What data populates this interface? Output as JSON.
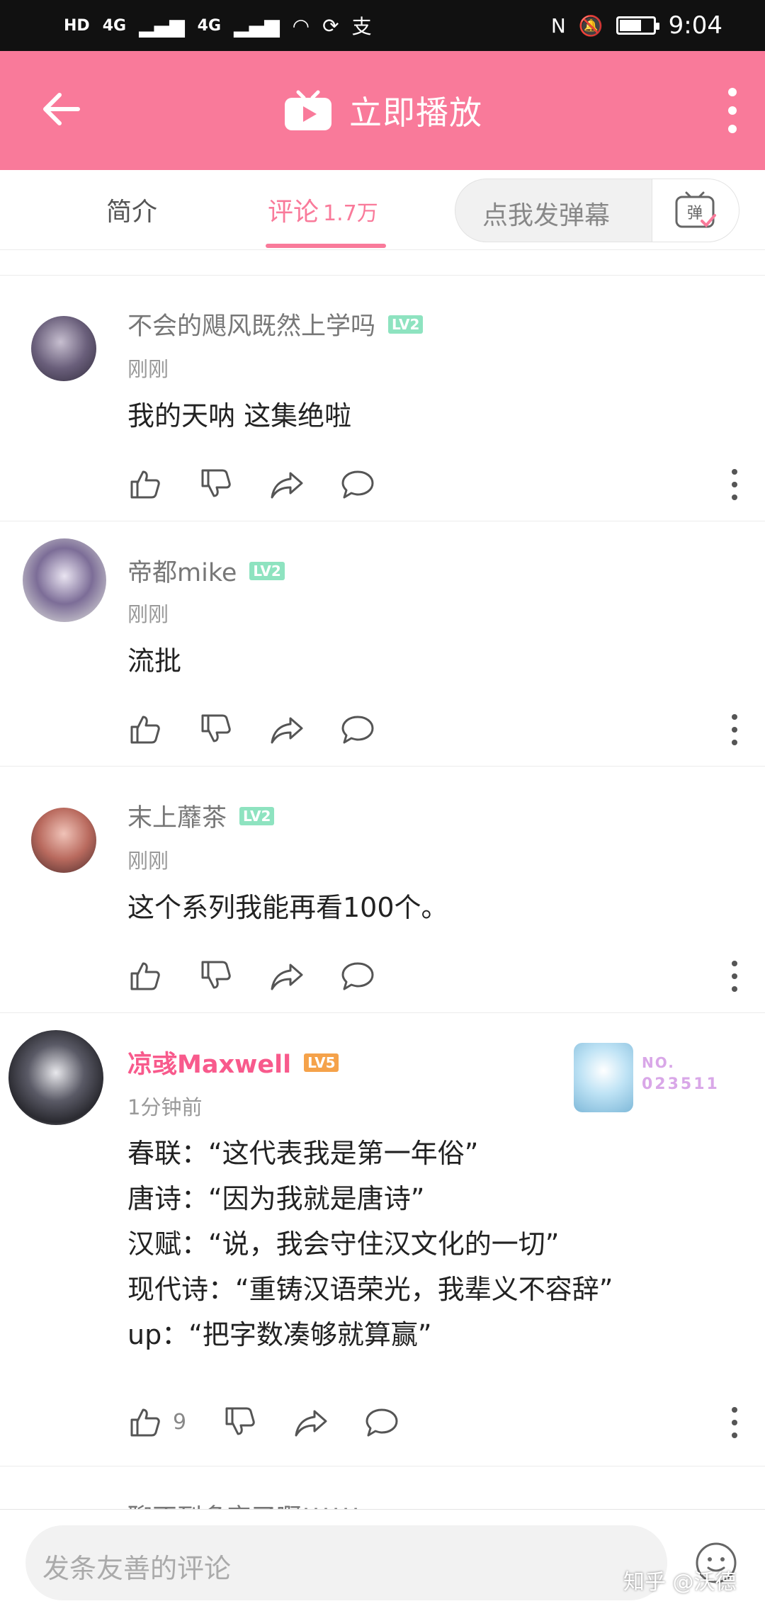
{
  "status_bar": {
    "sim1": "HD",
    "sim2": "HD",
    "net1": "4G",
    "net2": "4G",
    "app_badge": "支",
    "time": "9:04"
  },
  "app_bar": {
    "title": "立即播放",
    "accent_color": "#f97a9a"
  },
  "tabs": {
    "intro_label": "简介",
    "comments_label": "评论",
    "comments_count": "1.7万",
    "danmu_label": "点我发弹幕",
    "danmu_icon_char": "弹"
  },
  "comments": [
    {
      "username": "不会的飓风既然上学吗",
      "level": "LV2",
      "time": "刚刚",
      "text": "我的天呐 这集绝啦",
      "likes": ""
    },
    {
      "username": "帝都mike",
      "level": "LV2",
      "time": "刚刚",
      "text": "流批",
      "likes": ""
    },
    {
      "username": "末上蘼茶",
      "level": "LV2",
      "time": "刚刚",
      "text": "这个系列我能再看100个。",
      "likes": ""
    },
    {
      "username": "凉彧Maxwell",
      "level": "LV5",
      "time": "1分钟前",
      "text": "春联：“这代表我是第一年俗”\n唐诗：“因为我就是唐诗”\n汉赋：“说，我会守住汉文化的一切”\n现代诗：“重铸汉语荣光，我辈义不容辞”\nup：“把字数凑够就算赢”",
      "likes": "9",
      "badge_no": "NO.",
      "badge_number": "023511"
    }
  ],
  "next_comment_peek": "聊不到多字了啊!!!!!!",
  "bottom": {
    "input_placeholder": "发条友善的评论",
    "watermark": "知乎 @沃德"
  }
}
